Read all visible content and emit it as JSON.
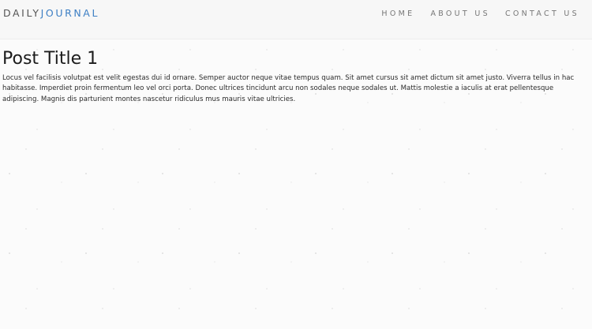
{
  "nav": {
    "brand_part1": "DAILY",
    "brand_part2": "JOURNAL",
    "links": [
      "HOME",
      "ABOUT US",
      "CONTACT US"
    ]
  },
  "post": {
    "title": "Post Title 1",
    "body": "Locus vel facilisis volutpat est velit egestas dui id ornare. Semper auctor neque vitae tempus quam. Sit amet cursus sit amet dictum sit amet justo. Viverra tellus in hac habitasse. Imperdiet proin fermentum leo vel orci porta. Donec ultrices tincidunt arcu non sodales neque sodales ut. Mattis molestie a iaculis at erat pellentesque adipiscing. Magnis dis parturient montes nascetur ridiculus mus mauris vitae ultricies."
  },
  "colors": {
    "brand_accent": "#3d7fc4",
    "navbar_background": "#f7f7f7"
  }
}
